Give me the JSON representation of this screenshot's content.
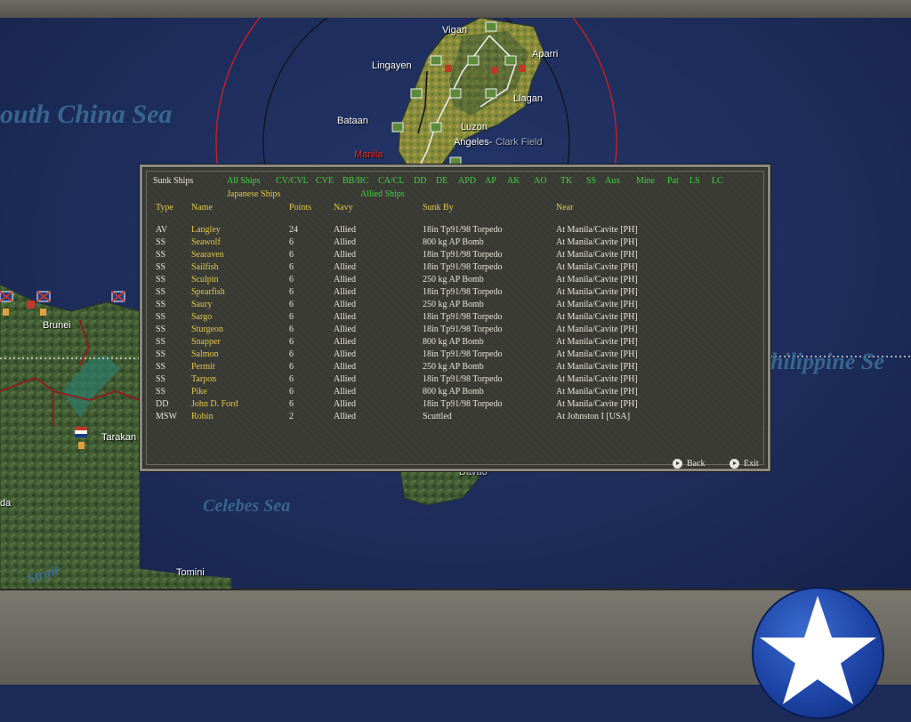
{
  "map": {
    "labels": [
      "Vigan",
      "Aparri",
      "Lingayen",
      "Llagan",
      "Bataan",
      "Luzon",
      "Angeles-",
      "Clark Field",
      "Manila",
      "Brunei",
      "Tarakan",
      "Tomini",
      "Davao",
      "da"
    ],
    "seas": [
      "outh China Sea",
      "Celebes Sea",
      "hilippine Se",
      "Strait"
    ]
  },
  "panel": {
    "title": "Sunk Ships",
    "filters_row1": [
      "All Ships",
      "CV/CVL",
      "CVE",
      "BB/BC",
      "CA/CL",
      "DD",
      "DE",
      "APD",
      "AP",
      "AK",
      "AO",
      "TK",
      "SS",
      "Aux",
      "Mine",
      "Pat",
      "LS",
      "LC"
    ],
    "filters_row2": {
      "japanese": "Japanese Ships",
      "allied": "Allied Ships"
    },
    "columns": [
      "Type",
      "Name",
      "Points",
      "Navy",
      "Sunk By",
      "Near"
    ],
    "rows": [
      {
        "type": "AV",
        "name": "Langley",
        "points": "24",
        "navy": "Allied",
        "sunk_by": "18in Tp91/98 Torpedo",
        "near": "At Manila/Cavite [PH]"
      },
      {
        "type": "SS",
        "name": "Seawolf",
        "points": "6",
        "navy": "Allied",
        "sunk_by": "800 kg AP Bomb",
        "near": "At Manila/Cavite [PH]"
      },
      {
        "type": "SS",
        "name": "Searaven",
        "points": "6",
        "navy": "Allied",
        "sunk_by": "18in Tp91/98 Torpedo",
        "near": "At Manila/Cavite [PH]"
      },
      {
        "type": "SS",
        "name": "Sailfish",
        "points": "6",
        "navy": "Allied",
        "sunk_by": "18in Tp91/98 Torpedo",
        "near": "At Manila/Cavite [PH]"
      },
      {
        "type": "SS",
        "name": "Sculpin",
        "points": "6",
        "navy": "Allied",
        "sunk_by": "250 kg AP Bomb",
        "near": "At Manila/Cavite [PH]"
      },
      {
        "type": "SS",
        "name": "Spearfish",
        "points": "6",
        "navy": "Allied",
        "sunk_by": "18in Tp91/98 Torpedo",
        "near": "At Manila/Cavite [PH]"
      },
      {
        "type": "SS",
        "name": "Saury",
        "points": "6",
        "navy": "Allied",
        "sunk_by": "250 kg AP Bomb",
        "near": "At Manila/Cavite [PH]"
      },
      {
        "type": "SS",
        "name": "Sargo",
        "points": "6",
        "navy": "Allied",
        "sunk_by": "18in Tp91/98 Torpedo",
        "near": "At Manila/Cavite [PH]"
      },
      {
        "type": "SS",
        "name": "Sturgeon",
        "points": "6",
        "navy": "Allied",
        "sunk_by": "18in Tp91/98 Torpedo",
        "near": "At Manila/Cavite [PH]"
      },
      {
        "type": "SS",
        "name": "Snapper",
        "points": "6",
        "navy": "Allied",
        "sunk_by": "800 kg AP Bomb",
        "near": "At Manila/Cavite [PH]"
      },
      {
        "type": "SS",
        "name": "Salmon",
        "points": "6",
        "navy": "Allied",
        "sunk_by": "18in Tp91/98 Torpedo",
        "near": "At Manila/Cavite [PH]"
      },
      {
        "type": "SS",
        "name": "Permit",
        "points": "6",
        "navy": "Allied",
        "sunk_by": "250 kg AP Bomb",
        "near": "At Manila/Cavite [PH]"
      },
      {
        "type": "SS",
        "name": "Tarpon",
        "points": "6",
        "navy": "Allied",
        "sunk_by": "18in Tp91/98 Torpedo",
        "near": "At Manila/Cavite [PH]"
      },
      {
        "type": "SS",
        "name": "Pike",
        "points": "6",
        "navy": "Allied",
        "sunk_by": "800 kg AP Bomb",
        "near": "At Manila/Cavite [PH]"
      },
      {
        "type": "DD",
        "name": "John D. Ford",
        "points": "6",
        "navy": "Allied",
        "sunk_by": "18in Tp91/98 Torpedo",
        "near": "At Manila/Cavite [PH]"
      },
      {
        "type": "MSW",
        "name": "Robin",
        "points": "2",
        "navy": "Allied",
        "sunk_by": "Scuttled",
        "near": "At Johnston I [USA]"
      }
    ],
    "back_label": "Back",
    "exit_label": "Exit"
  },
  "colors": {
    "filter": "#3fd23f",
    "name": "#e0c84a",
    "text": "#e6e6dc",
    "range_ring": "#c01f2a"
  }
}
